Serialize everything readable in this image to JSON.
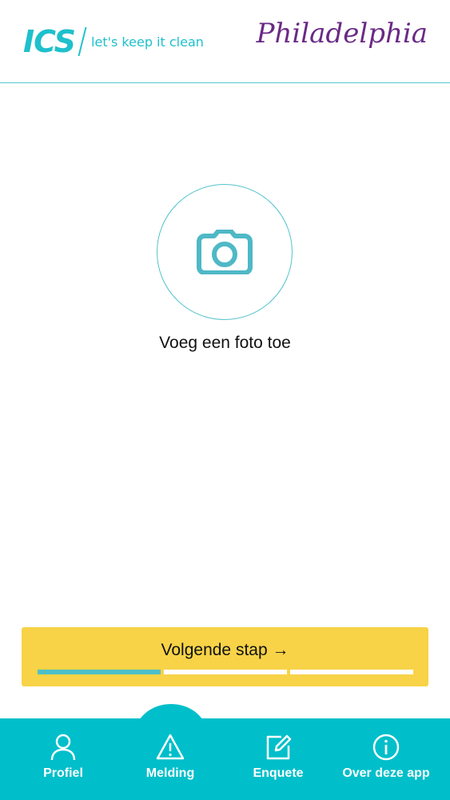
{
  "header": {
    "ics_logo": "ICS",
    "ics_tagline": "let's keep it clean",
    "partner_logo": "Philadelphia"
  },
  "main": {
    "add_photo_icon": "camera-icon",
    "add_photo_label": "Voeg een foto toe"
  },
  "next_step": {
    "label": "Volgende stap →",
    "progress": {
      "completed_steps": 1,
      "total_steps": 3
    }
  },
  "bottom_nav": {
    "items": [
      {
        "label": "Profiel",
        "icon": "person-icon"
      },
      {
        "label": "Melding",
        "icon": "warning-icon"
      },
      {
        "label": "Enquete",
        "icon": "edit-icon"
      },
      {
        "label": "Over deze app",
        "icon": "info-icon"
      }
    ]
  },
  "colors": {
    "accent": "#00bfca",
    "button": "#f8d347",
    "partner": "#6a2a85"
  }
}
